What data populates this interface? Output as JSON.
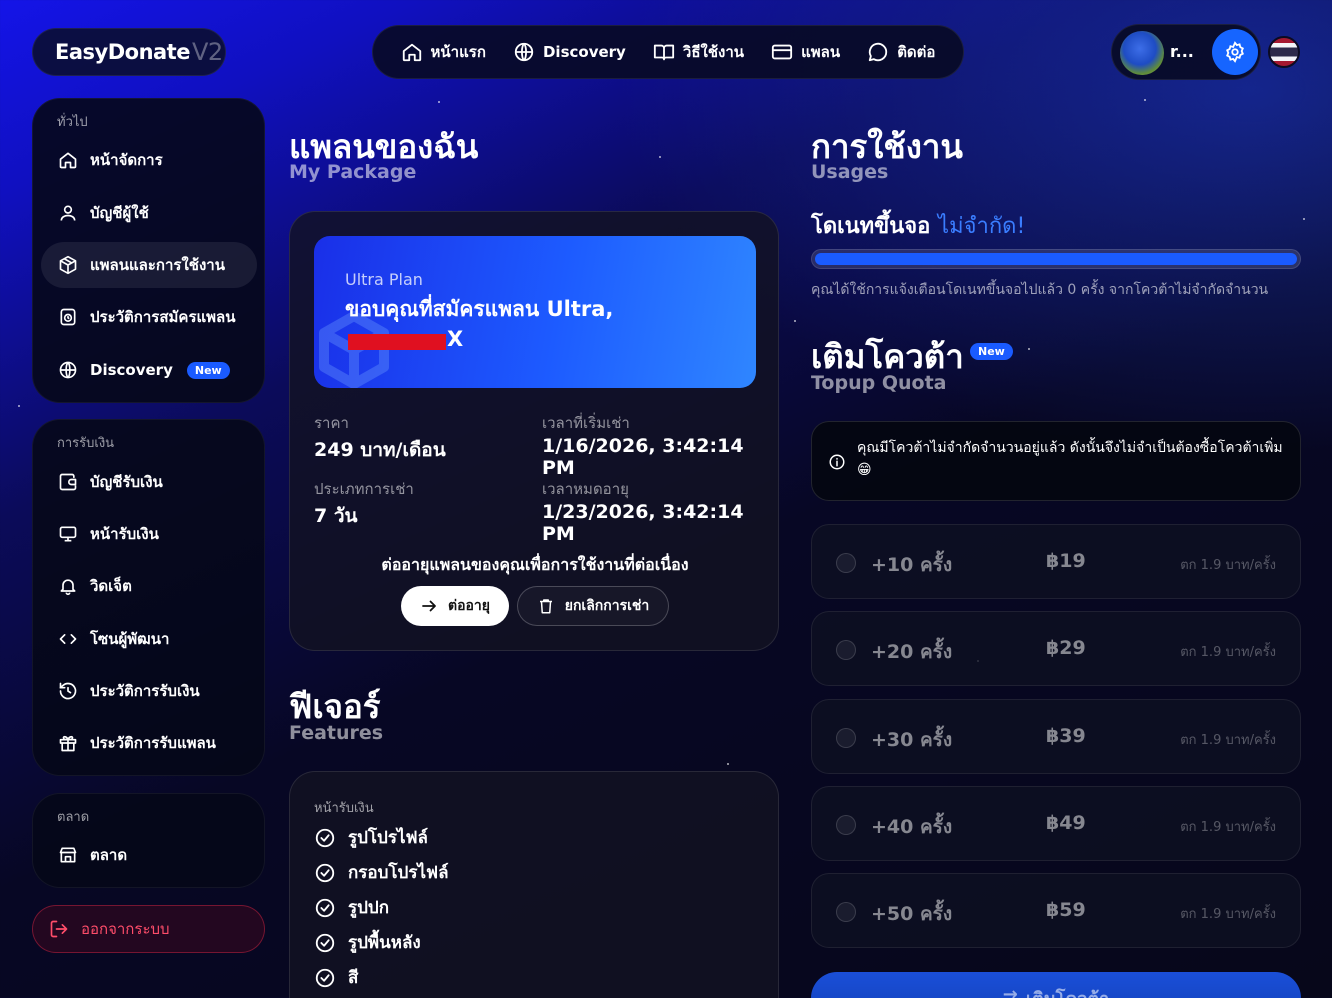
{
  "brand": {
    "name": "EasyDonate",
    "version": "V2"
  },
  "top_nav": [
    {
      "label": "หน้าแรก",
      "icon": "home-icon"
    },
    {
      "label": "Discovery",
      "icon": "globe-icon"
    },
    {
      "label": "วิธีใช้งาน",
      "icon": "book-icon"
    },
    {
      "label": "แพลน",
      "icon": "card-icon"
    },
    {
      "label": "ติดต่อ",
      "icon": "chat-icon"
    }
  ],
  "user": {
    "name": "r..."
  },
  "sidebar": {
    "general": {
      "label": "ทั่วไป",
      "items": [
        {
          "label": "หน้าจัดการ",
          "icon": "home-icon"
        },
        {
          "label": "บัญชีผู้ใช้",
          "icon": "user-icon"
        },
        {
          "label": "แพลนและการใช้งาน",
          "icon": "package-icon",
          "active": true
        },
        {
          "label": "ประวัติการสมัครแพลน",
          "icon": "history-icon"
        },
        {
          "label": "Discovery",
          "icon": "globe-icon",
          "badge": "New"
        }
      ]
    },
    "receiving": {
      "label": "การรับเงิน",
      "items": [
        {
          "label": "บัญชีรับเงิน",
          "icon": "wallet-icon"
        },
        {
          "label": "หน้ารับเงิน",
          "icon": "monitor-icon"
        },
        {
          "label": "วิดเจ็ต",
          "icon": "bell-icon"
        },
        {
          "label": "โซนผู้พัฒนา",
          "icon": "code-icon"
        },
        {
          "label": "ประวัติการรับเงิน",
          "icon": "history-icon"
        },
        {
          "label": "ประวัติการรับแพลน",
          "icon": "gift-icon"
        }
      ]
    },
    "market": {
      "label": "ตลาด",
      "items": [
        {
          "label": "ตลาด",
          "icon": "store-icon"
        }
      ]
    },
    "logout_label": "ออกจากระบบ"
  },
  "package": {
    "title": "แพลนของฉัน",
    "subtitle": "My Package",
    "plan_name": "Ultra Plan",
    "thanks": "ขอบคุณที่สมัครแพลน Ultra,",
    "thanks_line2": "X",
    "price_label": "ราคา",
    "price_value": "249 บาท/เดือน",
    "start_label": "เวลาที่เริ่มเช่า",
    "start_value": "1/16/2026, 3:42:14 PM",
    "type_label": "ประเภทการเช่า",
    "type_value": "7 วัน",
    "expire_label": "เวลาหมดอายุ",
    "expire_value": "1/23/2026, 3:42:14 PM",
    "renew_prompt": "ต่ออายุแพลนของคุณเพื่อการใช้งานที่ต่อเนื่อง",
    "renew_button": "ต่ออายุ",
    "cancel_button": "ยกเลิกการเช่า"
  },
  "features": {
    "title": "ฟีเจอร์",
    "subtitle": "Features",
    "section_label": "หน้ารับเงิน",
    "items": [
      "รูปโปรไฟล์",
      "กรอบโปรไฟล์",
      "รูปปก",
      "รูปพื้นหลัง",
      "สี"
    ]
  },
  "usage": {
    "title": "การใช้งาน",
    "subtitle": "Usages",
    "donate_label": "โดเนทขึ้นจอ",
    "donate_accent": "ไม่จำกัด!",
    "progress": 1.0,
    "note": "คุณได้ใช้การแจ้งเตือนโดเนทขึ้นจอไปแล้ว 0 ครั้ง จากโควต้าไม่จำกัดจำนวน"
  },
  "topup": {
    "title": "เติมโควต้า",
    "subtitle": "Topup Quota",
    "badge": "New",
    "notice": "คุณมีโควต้าไม่จำกัดจำนวนอยู่แล้ว ดังนั้นจึงไม่จำเป็นต้องซื้อโควต้าเพิ่ม 😁",
    "options": [
      {
        "amount": "+10 ครั้ง",
        "price": "฿19",
        "rate": "ตก 1.9 บาท/ครั้ง"
      },
      {
        "amount": "+20 ครั้ง",
        "price": "฿29",
        "rate": "ตก 1.9 บาท/ครั้ง"
      },
      {
        "amount": "+30 ครั้ง",
        "price": "฿39",
        "rate": "ตก 1.9 บาท/ครั้ง"
      },
      {
        "amount": "+40 ครั้ง",
        "price": "฿49",
        "rate": "ตก 1.9 บาท/ครั้ง"
      },
      {
        "amount": "+50 ครั้ง",
        "price": "฿59",
        "rate": "ตก 1.9 บาท/ครั้ง"
      }
    ],
    "button": "เติมโควต้า"
  },
  "colors": {
    "accent": "#1a5bff",
    "danger": "#ff4d6a"
  }
}
